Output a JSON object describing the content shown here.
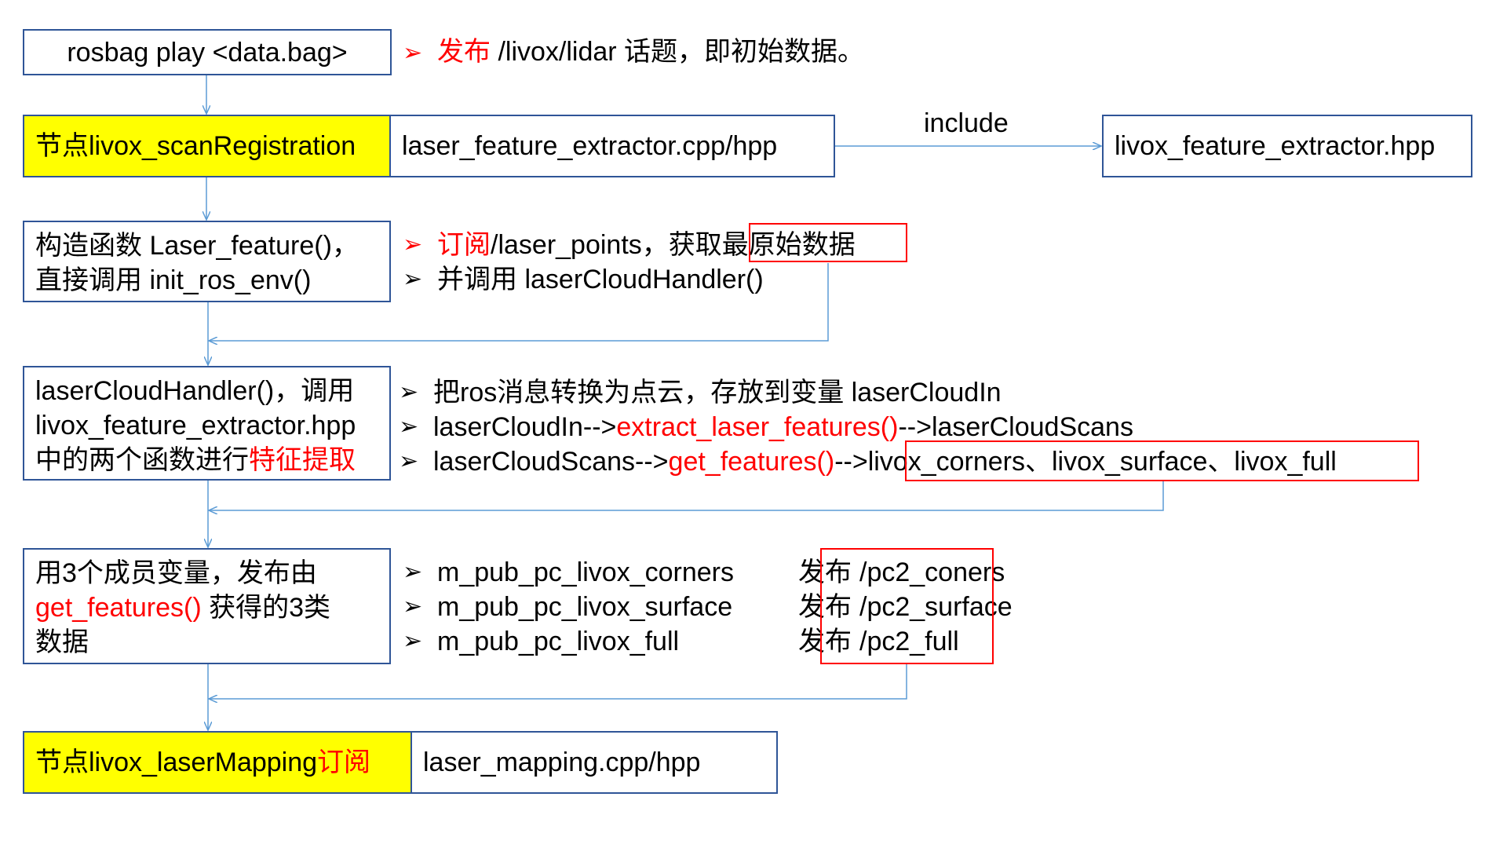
{
  "step_play": {
    "box_text": "rosbag play <data.bag>",
    "note_verb": "发布",
    "note_rest": " /livox/lidar 话题，即初始数据。"
  },
  "step_node": {
    "label": "节点livox_scanRegistration",
    "file": "laser_feature_extractor.cpp/hpp",
    "include_label": "include",
    "include_target": "livox_feature_extractor.hpp"
  },
  "step_constructor": {
    "line1": "构造函数 Laser_feature()，",
    "line2": "直接调用 init_ros_env()",
    "bullet1_verb": "订阅",
    "bullet1_mid": " /laser_points，获取",
    "bullet1_highlight": "最原始数据",
    "bullet2": "并调用 laserCloudHandler()"
  },
  "step_handler": {
    "line1": "laserCloudHandler()，调用",
    "line2": "livox_feature_extractor.hpp",
    "line3_plain": "中的两个函数进行",
    "line3_red": "特征提取",
    "bullet1": "把ros消息转换为点云，存放到变量 laserCloudIn",
    "bullet2_a": "laserCloudIn-->",
    "bullet2_red": "extract_laser_features()",
    "bullet2_b": "-->laserCloudScans",
    "bullet3_a": "laserCloudScans-->",
    "bullet3_red": "get_features()",
    "bullet3_b": " -->",
    "bullet3_highlight": "livox_corners、livox_surface、livox_full"
  },
  "step_publish": {
    "line1": "用3个成员变量，发布由",
    "line2_red": "get_features()",
    "line2_plain": " 获得的3类",
    "line3": "数据",
    "rows": [
      {
        "member": "m_pub_pc_livox_corners",
        "verb": "发布",
        "topic": "/pc2_coners"
      },
      {
        "member": "m_pub_pc_livox_surface",
        "verb": "发布",
        "topic": "/pc2_surface"
      },
      {
        "member": "m_pub_pc_livox_full",
        "verb": "发布",
        "topic": "/pc2_full"
      }
    ]
  },
  "step_mapping": {
    "label_plain": "节点livox_laserMapping",
    "label_red": "订阅",
    "file": "laser_mapping.cpp/hpp"
  },
  "icons": {
    "bullet": "➢"
  },
  "colors": {
    "box_border": "#2f5597",
    "highlight": "#ff0000",
    "node_fill": "#ffff00",
    "connector": "#5b9bd5"
  }
}
